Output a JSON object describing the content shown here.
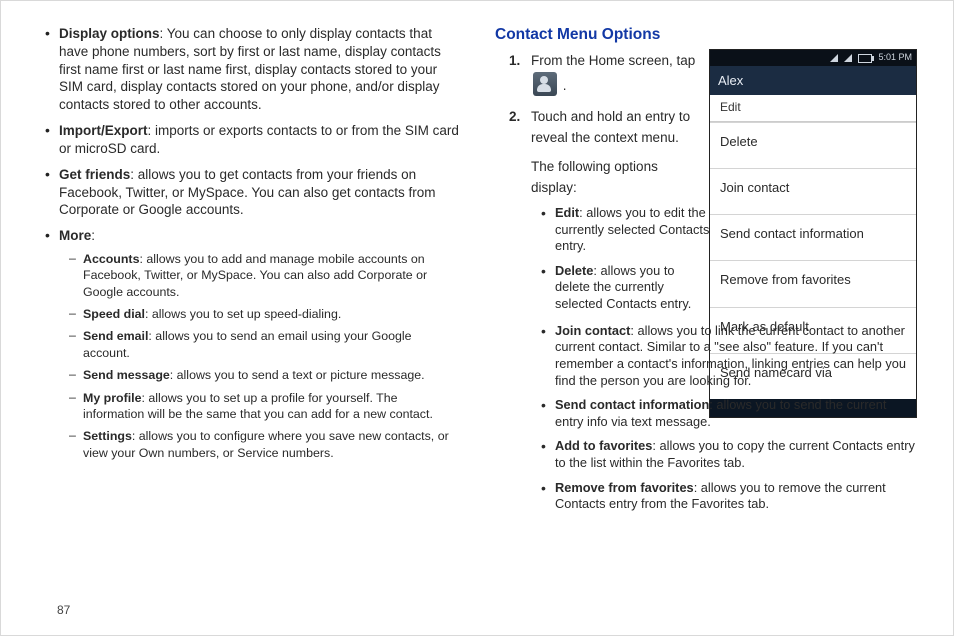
{
  "pageNumber": "87",
  "leftColumn": {
    "items": [
      {
        "term": "Display options",
        "text": ": You can choose to only display contacts that have phone numbers, sort by first or last name, display contacts first name first or last name first, display contacts stored to your SIM card, display contacts stored on your phone, and/or display contacts stored to other accounts."
      },
      {
        "term": "Import/Export",
        "text": ": imports or exports contacts to or from the SIM card or microSD card."
      },
      {
        "term": "Get friends",
        "text": ": allows you to get contacts from your friends on Facebook, Twitter, or MySpace. You can also get contacts from Corporate or Google accounts."
      },
      {
        "term": "More",
        "text": ":"
      }
    ],
    "moreSub": [
      {
        "term": "Accounts",
        "text": ": allows you to add and manage mobile accounts on Facebook, Twitter, or MySpace. You can also add Corporate or Google accounts."
      },
      {
        "term": "Speed dial",
        "text": ": allows you to set up speed-dialing."
      },
      {
        "term": "Send email",
        "text": ": allows you to send an email using your Google account."
      },
      {
        "term": "Send message",
        "text": ": allows you to send a text or picture message."
      },
      {
        "term": "My profile",
        "text": ": allows you to set up a profile for yourself. The information will be the same that you can add for a new contact."
      },
      {
        "term": "Settings",
        "text": ": allows you to configure where you save new contacts, or view your Own numbers, or Service numbers."
      }
    ]
  },
  "rightColumn": {
    "heading": "Contact Menu Options",
    "steps": [
      {
        "pre": "From the Home screen, tap ",
        "post": " ."
      },
      {
        "text": "Touch and hold an entry to reveal the context menu.",
        "followupA": "The following options",
        "followupB": "display:"
      }
    ],
    "optionsNarrow": [
      {
        "term": "Edit",
        "text": ": allows you to edit the currently selected Contacts entry."
      },
      {
        "term": "Delete",
        "text": ": allows you to delete the currently selected Contacts entry."
      }
    ],
    "optionsWide": [
      {
        "term": "Join contact",
        "text": ": allows you to link the current contact to another current contact. Similar to a \"see also\" feature. If you can't remember a contact's information, linking entries can help you find the person you are looking for."
      },
      {
        "term": "Send contact information",
        "text": ": allows you to send the current entry info via text message."
      },
      {
        "term": "Add to favorites",
        "text": ": allows you to copy the current Contacts entry to the list within the Favorites tab."
      },
      {
        "term": "Remove from favorites",
        "text": ": allows you to remove the current Contacts entry from the Favorites tab."
      }
    ]
  },
  "phone": {
    "time": "5:01 PM",
    "title": "Alex",
    "editTop": "Edit",
    "menu": [
      "Delete",
      "Join contact",
      "Send contact information",
      "Remove from favorites",
      "Mark as default",
      "Send namecard via"
    ],
    "footer": ""
  }
}
